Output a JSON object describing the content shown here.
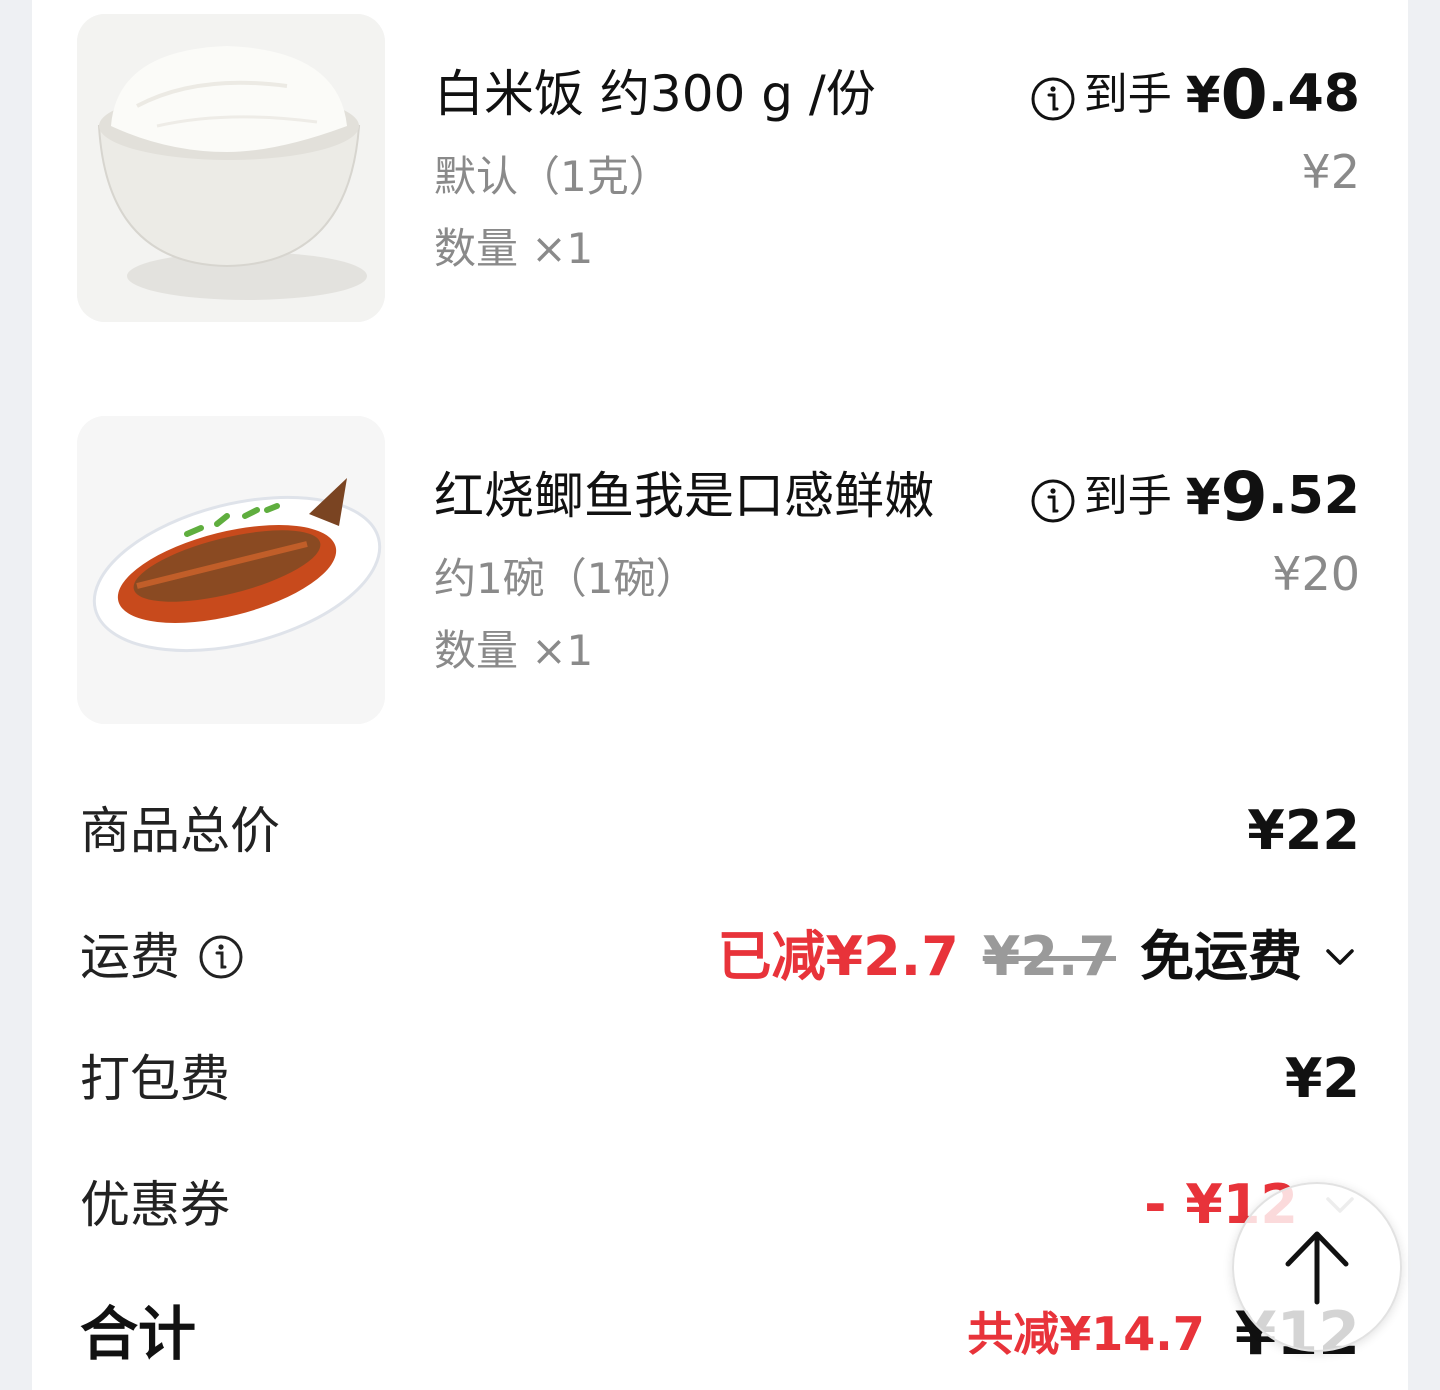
{
  "items": [
    {
      "name": "白米饭 约300 g /份",
      "spec": "默认（1克）",
      "qty": "数量 ×1",
      "daoshou_label": "到手",
      "currency": "¥",
      "price_int": "0",
      "price_dec": ".48",
      "orig_price": "¥2",
      "image": "rice-bowl-photo"
    },
    {
      "name": "红烧鲫鱼我是口感鲜嫩",
      "spec": "约1碗（1碗）",
      "qty": "数量 ×1",
      "daoshou_label": "到手",
      "currency": "¥",
      "price_int": "9",
      "price_dec": ".52",
      "orig_price": "¥20",
      "image": "braised-fish-photo"
    }
  ],
  "summary": {
    "subtotal_label": "商品总价",
    "subtotal_value": "¥22",
    "delivery_label": "运费",
    "delivery_discount": "已减¥2.7",
    "delivery_original": "¥2.7",
    "delivery_value": "免运费",
    "packing_label": "打包费",
    "packing_value": "¥2",
    "coupon_label": "优惠券",
    "coupon_value": "- ¥12",
    "total_label": "合计",
    "total_saved_prefix": "共减",
    "total_saved_amount": "¥14.7",
    "total_value": "¥12"
  },
  "colors": {
    "accent_red": "#e8333a",
    "muted_gray": "#8a8a8a",
    "text": "#111111"
  },
  "icons": {
    "info": "info-circle-icon",
    "chevron": "chevron-down-icon",
    "back_to_top": "arrow-up-icon"
  }
}
